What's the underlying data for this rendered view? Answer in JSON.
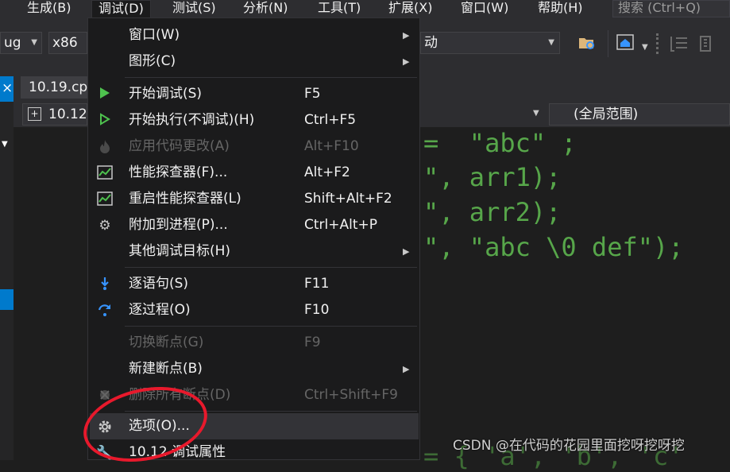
{
  "menubar": {
    "items": [
      {
        "label": "生成(B)"
      },
      {
        "label": "调试(D)"
      },
      {
        "label": "测试(S)"
      },
      {
        "label": "分析(N)"
      },
      {
        "label": "工具(T)"
      },
      {
        "label": "扩展(X)"
      },
      {
        "label": "窗口(W)"
      },
      {
        "label": "帮助(H)"
      }
    ],
    "search_placeholder": "搜索 (Ctrl+Q)"
  },
  "toolbar": {
    "config_value": "ug",
    "platform_value": "x86",
    "launch_value": "动"
  },
  "editor": {
    "tab_label": "10.19.cp",
    "file_combo_value": "10.12",
    "scope_value": "(全局范围)",
    "code_lines": [
      "=  \"abc\" ;",
      "\", arr1);",
      "\", arr2);",
      "\", \"abc \\0 def\");"
    ],
    "partial_bottom_line": "= { 'a', 'b', 'c'"
  },
  "debug_menu": {
    "items": [
      {
        "label": "窗口(W)",
        "shortcut": "",
        "submenu": true,
        "disabled": false,
        "icon": ""
      },
      {
        "label": "图形(C)",
        "shortcut": "",
        "submenu": true,
        "disabled": false,
        "icon": ""
      },
      {
        "label": "开始调试(S)",
        "shortcut": "F5",
        "submenu": false,
        "disabled": false,
        "icon": "play-icon"
      },
      {
        "label": "开始执行(不调试)(H)",
        "shortcut": "Ctrl+F5",
        "submenu": false,
        "disabled": false,
        "icon": "play-outline-icon"
      },
      {
        "label": "应用代码更改(A)",
        "shortcut": "Alt+F10",
        "submenu": false,
        "disabled": true,
        "icon": "flame-icon"
      },
      {
        "label": "性能探查器(F)...",
        "shortcut": "Alt+F2",
        "submenu": false,
        "disabled": false,
        "icon": "performance-chart-icon"
      },
      {
        "label": "重启性能探查器(L)",
        "shortcut": "Shift+Alt+F2",
        "submenu": false,
        "disabled": false,
        "icon": "performance-chart-icon"
      },
      {
        "label": "附加到进程(P)...",
        "shortcut": "Ctrl+Alt+P",
        "submenu": false,
        "disabled": false,
        "icon": "gears-icon"
      },
      {
        "label": "其他调试目标(H)",
        "shortcut": "",
        "submenu": true,
        "disabled": false,
        "icon": ""
      },
      {
        "label": "逐语句(S)",
        "shortcut": "F11",
        "submenu": false,
        "disabled": false,
        "icon": "step-into-icon"
      },
      {
        "label": "逐过程(O)",
        "shortcut": "F10",
        "submenu": false,
        "disabled": false,
        "icon": "step-over-icon"
      },
      {
        "label": "切换断点(G)",
        "shortcut": "F9",
        "submenu": false,
        "disabled": true,
        "icon": ""
      },
      {
        "label": "新建断点(B)",
        "shortcut": "",
        "submenu": true,
        "disabled": false,
        "icon": ""
      },
      {
        "label": "删除所有断点(D)",
        "shortcut": "Ctrl+Shift+F9",
        "submenu": false,
        "disabled": true,
        "icon": "delete-breakpoints-icon"
      },
      {
        "label": "选项(O)...",
        "shortcut": "",
        "submenu": false,
        "disabled": false,
        "icon": "gear-icon"
      },
      {
        "label": "10.12 调试属性",
        "shortcut": "",
        "submenu": false,
        "disabled": false,
        "icon": "wrench-icon"
      }
    ]
  },
  "watermark": "CSDN @在代码的花园里面挖呀挖呀挖",
  "colors": {
    "accent_blue": "#007acc",
    "annotation_red": "#e8192c",
    "code_green": "#57a64a",
    "play_green": "#4ec24e"
  }
}
